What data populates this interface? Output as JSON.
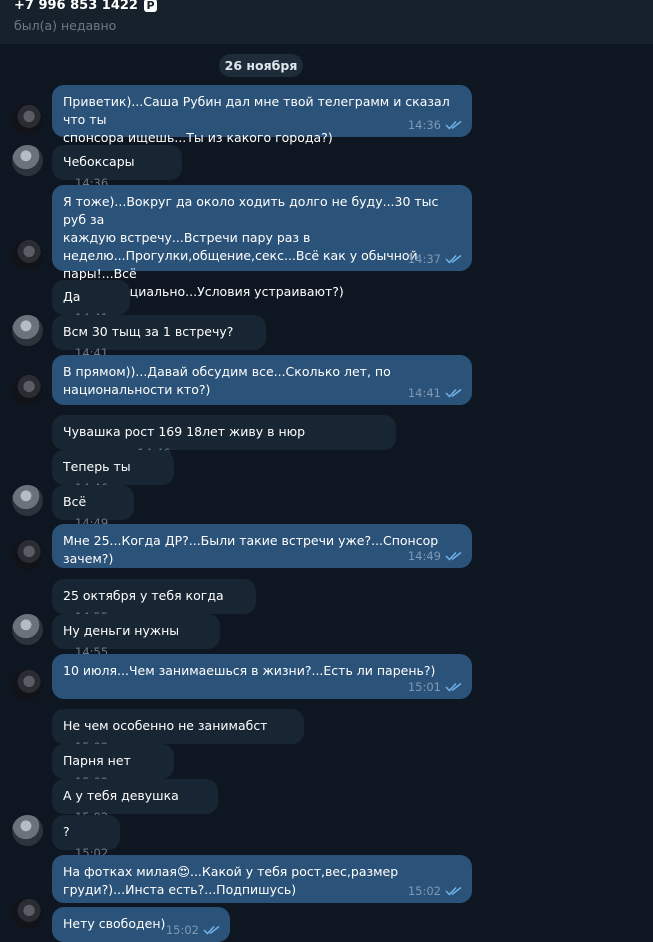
{
  "header": {
    "phone": "+7 996 853 1422",
    "badge": "P",
    "status": "был(а) недавно"
  },
  "date_separator": "26 ноября",
  "messages": [
    {
      "text": "Приветик)...Саша Рубин дал мне твой телеграмм и сказал что ты\nспонсора ищешь...Ты из какого города?)",
      "time": "14:36"
    },
    {
      "text": "Чебоксары",
      "time": "14:36"
    },
    {
      "text": "Я тоже)...Вокруг да около ходить долго не буду...30 тыс руб за\nкаждую встречу...Встречи пару раз в\nнеделю...Прогулки,общение,секс...Всё как у обычной пары!...Всё\nконфиденциально...Условия устраивают?)",
      "time": "14:37"
    },
    {
      "text": "Да",
      "time": "14:41"
    },
    {
      "text": "Всм 30 тыщ за 1 встречу?",
      "time": "14:41"
    },
    {
      "text": "В прямом))...Давай обсудим все...Сколько лет, по\nнациональности кто?)",
      "time": "14:41"
    },
    {
      "text": "Чувашка рост 169 18лет живу в нюр",
      "edited": "изменено",
      "time": "14:46"
    },
    {
      "text": "Теперь ты",
      "time": "14:46"
    },
    {
      "text": "Всё",
      "time": "14:49"
    },
    {
      "text": "Мне 25...Когда ДР?...Были такие встречи уже?...Спонсор зачем?)",
      "time": "14:49"
    },
    {
      "text": "25 октября у тебя когда",
      "time": "14:55"
    },
    {
      "text": "Ну деньги нужны",
      "time": "14:55"
    },
    {
      "text": "10 июля...Чем занимаешься в жизни?...Есть ли парень?)",
      "time": "15:01"
    },
    {
      "text": "Не чем особенно не занимабст",
      "time": "15:02"
    },
    {
      "text": "Парня нет",
      "time": "15:02"
    },
    {
      "text": "А у тебя девушка",
      "time": "15:02"
    },
    {
      "text": "?",
      "time": "15:02"
    },
    {
      "text": "На фотках милая😍...Какой у тебя рост,вес,размер\nгруди?)...Инста есть?...Подпишусь)",
      "time": "15:02"
    },
    {
      "text": "Нету свободен)",
      "time": "15:02"
    }
  ],
  "colors": {
    "background": "#0e1621",
    "outgoing": "#2b5278",
    "incoming": "#182533",
    "checks": "#6fb1e8"
  }
}
